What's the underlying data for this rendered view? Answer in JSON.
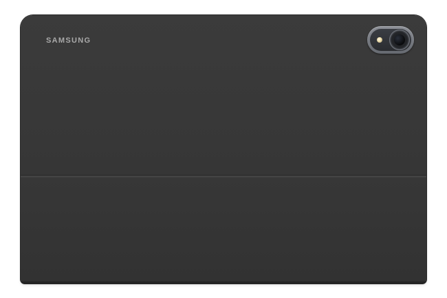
{
  "product": {
    "brand_text": "SAMSUNG",
    "body_color": "#363636",
    "camera_ring_color": "#7a7d84"
  }
}
